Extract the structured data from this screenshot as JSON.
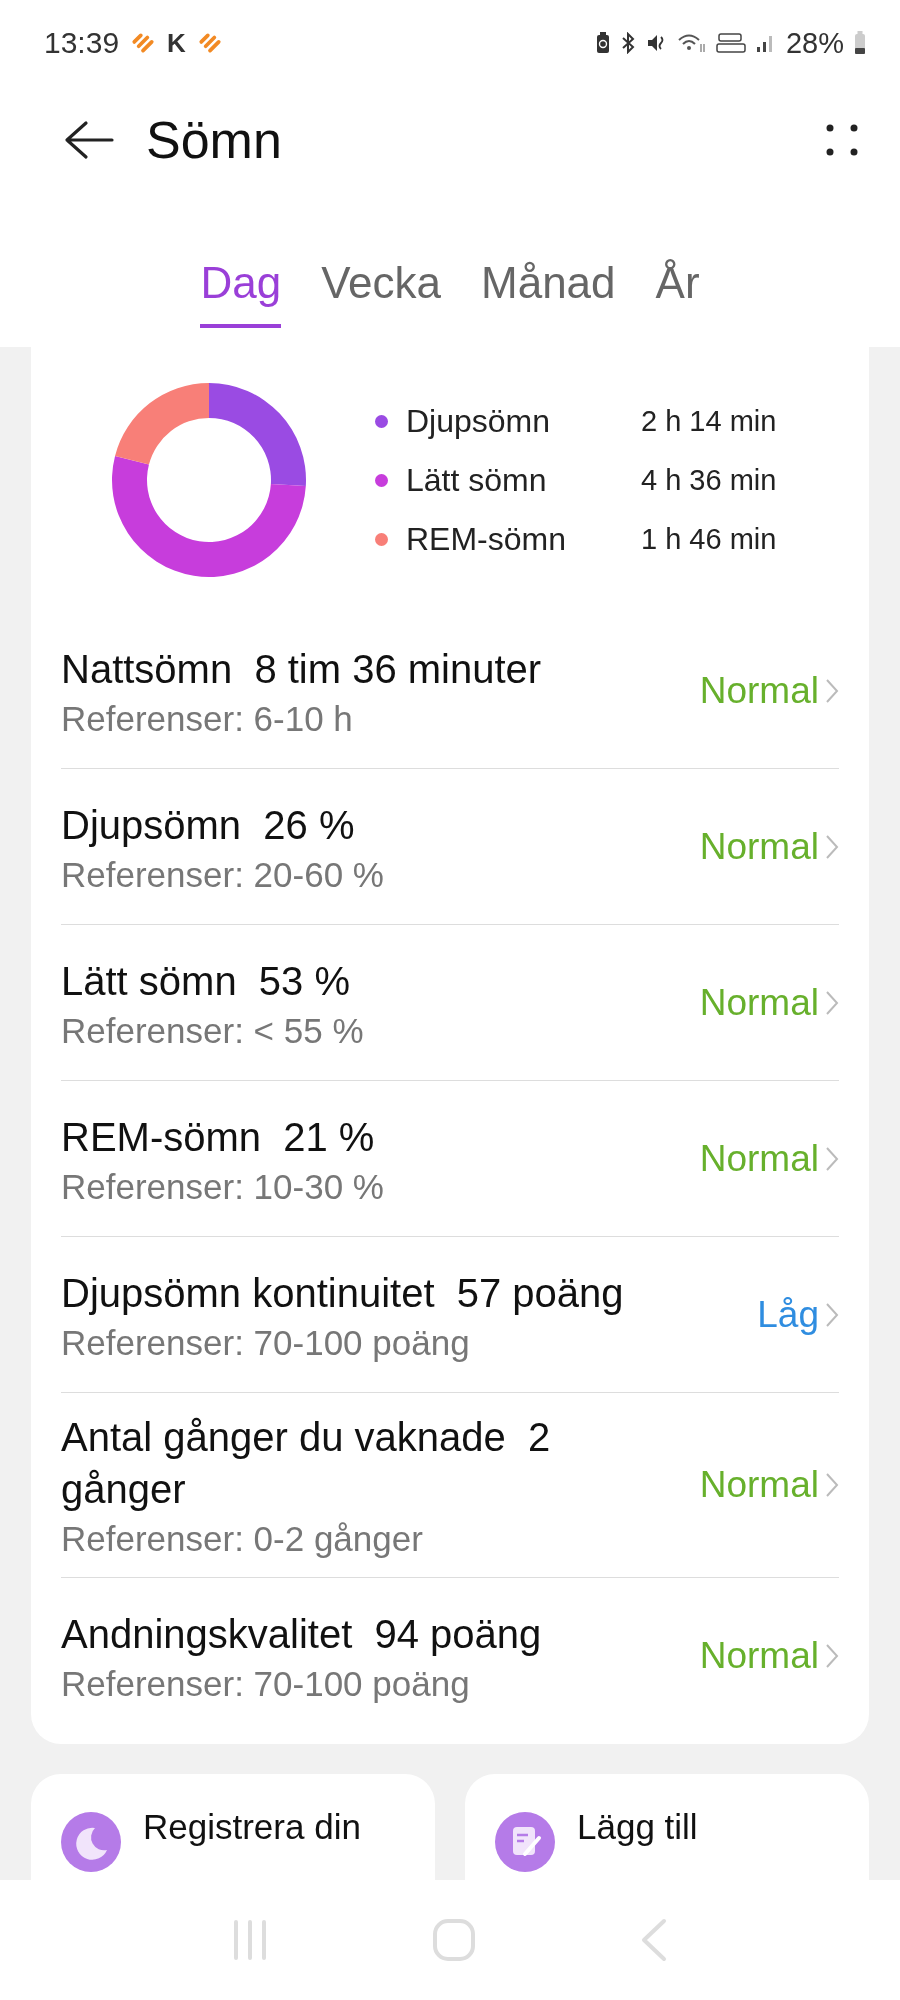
{
  "status_bar": {
    "time": "13:39",
    "carrier_letter": "K",
    "battery": "28%"
  },
  "header": {
    "title": "Sömn"
  },
  "tabs": [
    {
      "label": "Dag",
      "selected": true
    },
    {
      "label": "Vecka",
      "selected": false
    },
    {
      "label": "Månad",
      "selected": false
    },
    {
      "label": "År",
      "selected": false
    }
  ],
  "summary": {
    "chart_data": {
      "type": "donut",
      "categories": [
        "Djupsömn",
        "Lätt sömn",
        "REM-sömn"
      ],
      "values": [
        26,
        53,
        21
      ]
    },
    "legend": [
      {
        "value": "2 h 14 min",
        "color": "#9a4be3"
      },
      {
        "value": "4 h 36 min",
        "color": "#c73ddc"
      },
      {
        "value": "1 h 46 min",
        "color": "#f87f78"
      }
    ]
  },
  "metrics": [
    {
      "title": "Nattsömn  8 tim 36 minuter",
      "reference": "Referenser: 6-10 h",
      "status": "Normal",
      "kind": "normal"
    },
    {
      "title": "Djupsömn  26 %",
      "reference": "Referenser: 20-60 %",
      "status": "Normal",
      "kind": "normal"
    },
    {
      "title": "Lätt sömn  53 %",
      "reference": "Referenser: < 55 %",
      "status": "Normal",
      "kind": "normal"
    },
    {
      "title": "REM-sömn  21 %",
      "reference": "Referenser: 10-30 %",
      "status": "Normal",
      "kind": "normal"
    },
    {
      "title": "Djupsömn kontinuitet  57 poäng",
      "reference": "Referenser: 70-100 poäng",
      "status": "Låg",
      "kind": "low"
    },
    {
      "title": "Antal gånger du vaknade  2 gånger",
      "reference": "Referenser: 0-2 gånger",
      "status": "Normal",
      "kind": "normal"
    },
    {
      "title": "Andningskvalitet  94 poäng",
      "reference": "Referenser: 70-100 poäng",
      "status": "Normal",
      "kind": "normal"
    }
  ],
  "actions": [
    {
      "label": "Registrera din",
      "kind": "sleep"
    },
    {
      "label": "Lägg till",
      "kind": "note"
    }
  ]
}
